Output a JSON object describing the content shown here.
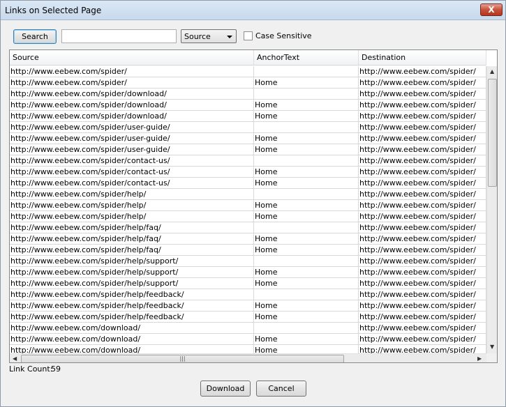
{
  "window": {
    "title": "Links on Selected Page",
    "close_label": "X"
  },
  "toolbar": {
    "search_label": "Search",
    "search_value": "",
    "field_select": "Source",
    "case_sensitive_label": "Case Sensitive"
  },
  "grid": {
    "columns": [
      "Source",
      "AnchorText",
      "Destination"
    ],
    "rows": [
      [
        "http://www.eebew.com/spider/",
        "",
        "http://www.eebew.com/spider/"
      ],
      [
        "http://www.eebew.com/spider/",
        "Home",
        "http://www.eebew.com/spider/"
      ],
      [
        "http://www.eebew.com/spider/download/",
        "",
        "http://www.eebew.com/spider/"
      ],
      [
        "http://www.eebew.com/spider/download/",
        "Home",
        "http://www.eebew.com/spider/"
      ],
      [
        "http://www.eebew.com/spider/download/",
        "Home",
        "http://www.eebew.com/spider/"
      ],
      [
        "http://www.eebew.com/spider/user-guide/",
        "",
        "http://www.eebew.com/spider/"
      ],
      [
        "http://www.eebew.com/spider/user-guide/",
        "Home",
        "http://www.eebew.com/spider/"
      ],
      [
        "http://www.eebew.com/spider/user-guide/",
        "Home",
        "http://www.eebew.com/spider/"
      ],
      [
        "http://www.eebew.com/spider/contact-us/",
        "",
        "http://www.eebew.com/spider/"
      ],
      [
        "http://www.eebew.com/spider/contact-us/",
        "Home",
        "http://www.eebew.com/spider/"
      ],
      [
        "http://www.eebew.com/spider/contact-us/",
        "Home",
        "http://www.eebew.com/spider/"
      ],
      [
        "http://www.eebew.com/spider/help/",
        "",
        "http://www.eebew.com/spider/"
      ],
      [
        "http://www.eebew.com/spider/help/",
        "Home",
        "http://www.eebew.com/spider/"
      ],
      [
        "http://www.eebew.com/spider/help/",
        "Home",
        "http://www.eebew.com/spider/"
      ],
      [
        "http://www.eebew.com/spider/help/faq/",
        "",
        "http://www.eebew.com/spider/"
      ],
      [
        "http://www.eebew.com/spider/help/faq/",
        "Home",
        "http://www.eebew.com/spider/"
      ],
      [
        "http://www.eebew.com/spider/help/faq/",
        "Home",
        "http://www.eebew.com/spider/"
      ],
      [
        "http://www.eebew.com/spider/help/support/",
        "",
        "http://www.eebew.com/spider/"
      ],
      [
        "http://www.eebew.com/spider/help/support/",
        "Home",
        "http://www.eebew.com/spider/"
      ],
      [
        "http://www.eebew.com/spider/help/support/",
        "Home",
        "http://www.eebew.com/spider/"
      ],
      [
        "http://www.eebew.com/spider/help/feedback/",
        "",
        "http://www.eebew.com/spider/"
      ],
      [
        "http://www.eebew.com/spider/help/feedback/",
        "Home",
        "http://www.eebew.com/spider/"
      ],
      [
        "http://www.eebew.com/spider/help/feedback/",
        "Home",
        "http://www.eebew.com/spider/"
      ],
      [
        "http://www.eebew.com/download/",
        "",
        "http://www.eebew.com/spider/"
      ],
      [
        "http://www.eebew.com/download/",
        "Home",
        "http://www.eebew.com/spider/"
      ],
      [
        "http://www.eebew.com/download/",
        "Home",
        "http://www.eebew.com/spider/"
      ]
    ]
  },
  "status": {
    "link_count_label": "Link Count:",
    "link_count_value": "59"
  },
  "footer": {
    "download_label": "Download",
    "cancel_label": "Cancel"
  }
}
